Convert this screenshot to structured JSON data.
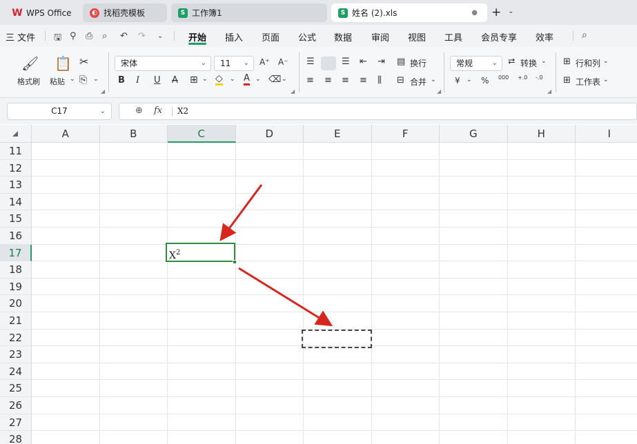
{
  "tabs": [
    {
      "label": "WPS Office",
      "icon": "wps-logo-icon"
    },
    {
      "label": "找稻壳模板",
      "icon": "docer-icon"
    },
    {
      "label": "工作簿1",
      "icon": "spreadsheet-icon"
    },
    {
      "label": "姓名 (2).xls",
      "icon": "spreadsheet-icon",
      "active": true
    }
  ],
  "tab_icon_letters": {
    "sheet": "S"
  },
  "tab_modified_dot": "●",
  "menu": {
    "file": "三 文件",
    "items": [
      "开始",
      "插入",
      "页面",
      "公式",
      "数据",
      "审阅",
      "视图",
      "工具",
      "会员专享",
      "效率"
    ],
    "active": "开始"
  },
  "ribbon": {
    "format_painter": "格式刷",
    "paste": "粘贴",
    "font_name": "宋体",
    "font_size": "11",
    "wrap": "换行",
    "merge": "合并",
    "number_format": "常规",
    "convert": "转换",
    "rows_cols": "行和列",
    "worksheet": "工作表",
    "bold": "B",
    "italic": "I",
    "underline": "U",
    "strike": "A",
    "font_color_glyph": "A",
    "grow_font": "A⁺",
    "shrink_font": "A⁻",
    "currency": "¥",
    "percent": "%",
    "thousands": "000",
    "inc_dec": "+.0",
    "dec_dec": "-.0"
  },
  "formula_bar": {
    "name_box": "C17",
    "fx": "fx",
    "content": "X2"
  },
  "grid": {
    "columns": [
      "A",
      "B",
      "C",
      "D",
      "E",
      "F",
      "G",
      "H",
      "I"
    ],
    "rows": [
      "11",
      "12",
      "13",
      "14",
      "15",
      "16",
      "17",
      "18",
      "19",
      "20",
      "21",
      "22",
      "23",
      "24",
      "25",
      "26",
      "27",
      "28"
    ],
    "selected_column": "C",
    "selected_row": "17",
    "active_cell": {
      "ref": "C17",
      "base": "X",
      "superscript": "2"
    },
    "copy_target": "E22"
  },
  "colors": {
    "accent": "#1f9e63",
    "active_border": "#2e8b3b",
    "arrow": "#d9261c"
  }
}
